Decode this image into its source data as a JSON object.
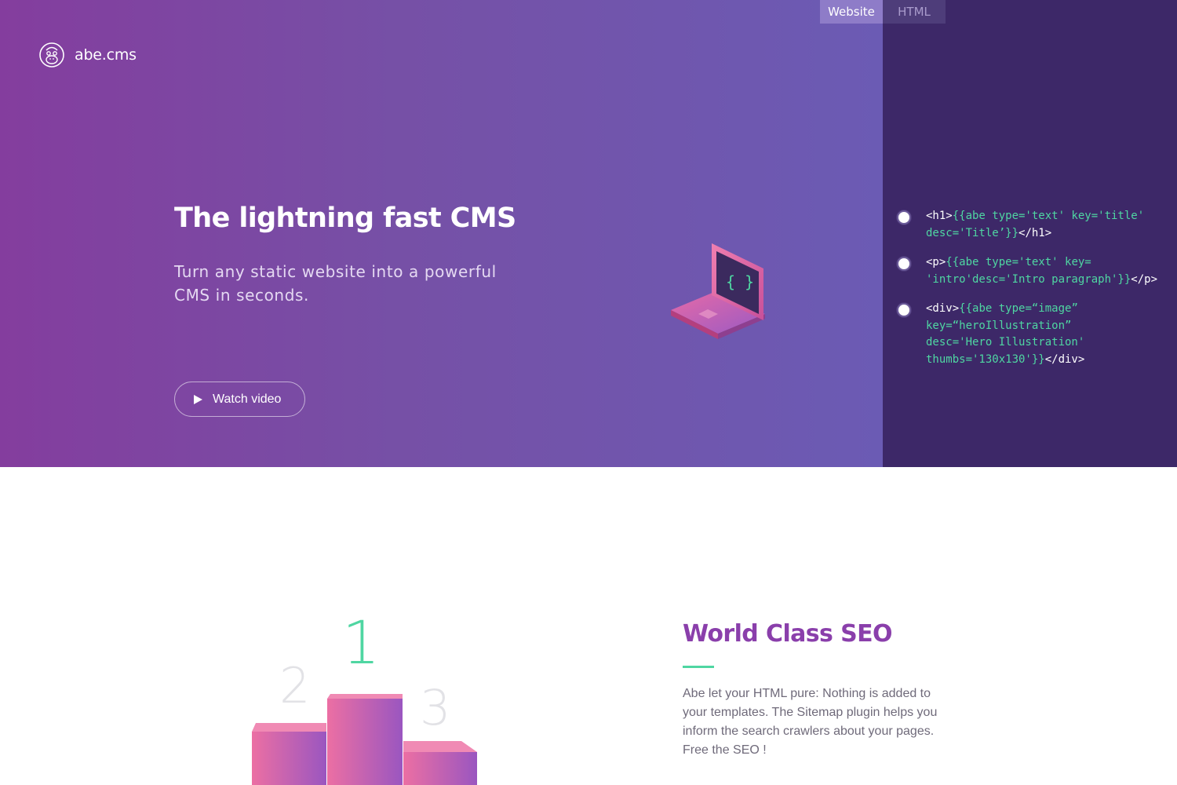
{
  "view_toggle": {
    "website": "Website",
    "html": "HTML",
    "active": "Website"
  },
  "brand": {
    "name": "abe.cms",
    "icon": "monkey-face-icon"
  },
  "hero": {
    "title": "The lightning fast CMS",
    "subtitle": "Turn any static website into a powerful CMS in seconds.",
    "cta_label": "Watch video",
    "cta_icon": "play-icon",
    "illustration": "laptop-code-icon",
    "illustration_glyph": "{ }"
  },
  "code_panel": {
    "lines": [
      {
        "open": "<h1>",
        "abe": "{{abe type='text' key='title'\ndesc='Title’}}",
        "close": "</h1>"
      },
      {
        "open": "<p>",
        "abe": "{{abe type='text' key=\n'intro'desc='Intro paragraph'}}",
        "close": "</p>"
      },
      {
        "open": "<div>",
        "abe": "{{abe type=“image”\nkey=“heroIllustration”\ndesc='Hero Illustration'\nthumbs='130x130'}}",
        "close": "</div>"
      }
    ]
  },
  "seo": {
    "title": "World Class SEO",
    "body": "Abe let your HTML pure: Nothing is added to your templates. The Sitemap plugin helps you inform the search crawlers about your pages. Free the SEO !",
    "podium": {
      "first": "1",
      "second": "2",
      "third": "3"
    }
  },
  "colors": {
    "accent_green": "#4fd6a2",
    "brand_purple": "#8a3fab",
    "panel_dark": "#3d2868"
  }
}
